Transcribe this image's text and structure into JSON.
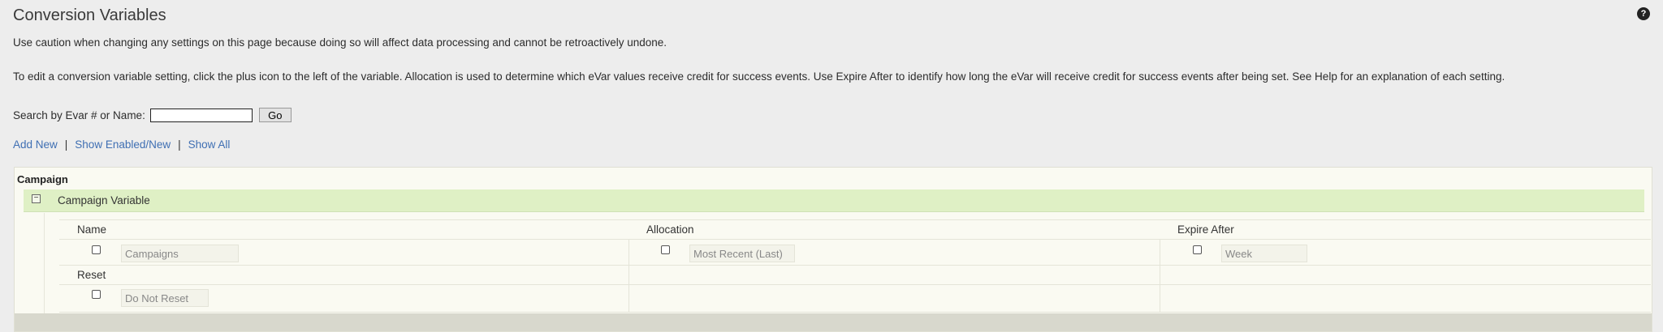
{
  "page": {
    "title": "Conversion Variables",
    "help_glyph": "?",
    "caution": "Use caution when changing any settings on this page because doing so will affect data processing and cannot be retroactively undone.",
    "instructions": "To edit a conversion variable setting, click the plus icon to the left of the variable. Allocation is used to determine which eVar values receive credit for success events. Use Expire After to identify how long the eVar will receive credit for success events after being set. See Help for an explanation of each setting."
  },
  "search": {
    "label": "Search by Evar # or Name:",
    "value": "",
    "placeholder": "",
    "go_label": "Go"
  },
  "links": {
    "add_new": "Add New",
    "separator": "|",
    "show_enabled": "Show Enabled/New",
    "show_all": "Show All"
  },
  "panel": {
    "label": "Campaign",
    "group": {
      "toggle_glyph": "−",
      "title": "Campaign Variable",
      "fields": {
        "name": {
          "label": "Name",
          "value": "Campaigns",
          "checked": false
        },
        "allocation": {
          "label": "Allocation",
          "value": "Most Recent (Last)",
          "checked": false
        },
        "expire_after": {
          "label": "Expire After",
          "value": "Week",
          "checked": false
        },
        "reset": {
          "label": "Reset",
          "value": "Do Not Reset",
          "checked": false
        }
      }
    }
  },
  "icons": {
    "help": "help-icon",
    "collapse": "minus-square-icon"
  },
  "colors": {
    "link": "#3f6fb3",
    "group_header": "#dff0c5",
    "page_bg": "#ededed"
  }
}
